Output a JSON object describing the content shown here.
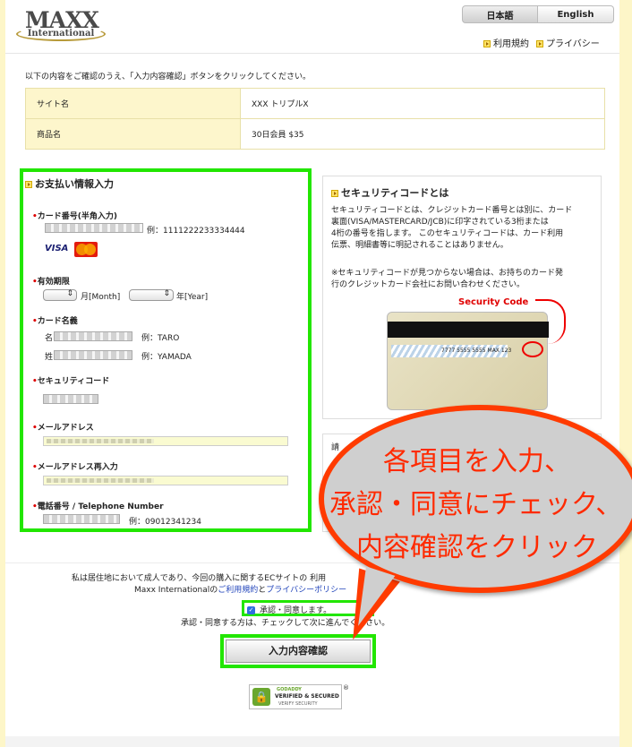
{
  "header": {
    "logo_main": "MAXX",
    "logo_sub": "International",
    "lang_ja": "日本語",
    "lang_en": "English",
    "link_terms": "利用規約",
    "link_privacy": "プライバシー"
  },
  "intro": "以下の内容をご確認のうえ、「入力内容確認」ボタンをクリックしてください。",
  "info": {
    "site_label": "サイト名",
    "site_value": "XXX トリプルX",
    "product_label": "商品名",
    "product_value": "30日会員 $35"
  },
  "payment": {
    "title": "お支払い情報入力",
    "card_label": "カード番号(半角入力)",
    "card_example": "例：1111222233334444",
    "visa": "VISA",
    "expiry_label": "有効期限",
    "month_text": "月[Month]",
    "year_text": "年[Year]",
    "name_label": "カード名義",
    "first_name": "名",
    "first_example": "例：TARO",
    "last_name": "姓",
    "last_example": "例：YAMADA",
    "security_label": "セキュリティコード",
    "email_label": "メールアドレス",
    "email_confirm_label": "メールアドレス再入力",
    "phone_label": "電話番号 / Telephone Number",
    "phone_example": "例：09012341234"
  },
  "security_info": {
    "title": "セキュリティコードとは",
    "line1": "セキュリティコードとは、クレジットカード番号とは別に、カード",
    "line2": "裏面(VISA/MASTERCARD/JCB)に印字されている3桁または",
    "line3": "4桁の番号を指します。 このセキュリティコードは、カード利用",
    "line4": "伝票、明細書等に明記されることはありません。",
    "line5": "※セキュリティコードが見つからない場合は、お持ちのカード発",
    "line6": "行のクレジットカード会社にお問い合わせください。",
    "code_label": "Security Code",
    "card_number": "7777 5555 5555 MAX 123"
  },
  "box2_text": "請",
  "agreement": {
    "line1": "私は居住地において成人であり、今回の購入に関するECサイトの 利用",
    "line2_prefix": "Maxx Internationalの",
    "line2_terms": "ご利用規約",
    "line2_and": "と",
    "line2_privacy": "プライバシーポリシー",
    "checkbox_label": "承認・同意します。",
    "line3": "承認・同意する方は、チェックして次に進んでください。",
    "confirm_button": "入力内容確認"
  },
  "seal": {
    "brand": "GODADDY",
    "line1": "VERIFIED & SECURED",
    "line2": "VERIFY SECURITY",
    "reg": "®"
  },
  "bubble": {
    "line1": "各項目を入力、",
    "line2": "承認・同意にチェック、",
    "line3": "内容確認をクリック"
  }
}
